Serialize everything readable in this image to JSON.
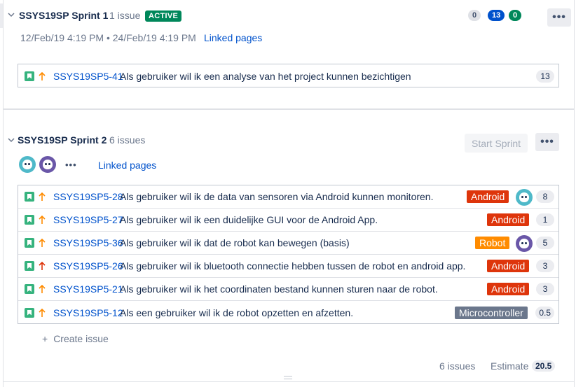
{
  "sprint1": {
    "name": "SSYS19SP Sprint 1",
    "issue_count": "1 issue",
    "status": "ACTIVE",
    "counts": {
      "todo": "0",
      "in_progress": "13",
      "done": "0"
    },
    "more": "•••",
    "dates": "12/Feb/19 4:19 PM • 24/Feb/19 4:19 PM",
    "linked_pages": "Linked pages",
    "issues": [
      {
        "key": "SSYS19SP5-41",
        "summary": "Als gebruiker wil ik een analyse van het project kunnen bezichtigen",
        "estimate": "13",
        "priority_color": "#ff8b00"
      }
    ]
  },
  "sprint2": {
    "name": "SSYS19SP Sprint 2",
    "issue_count": "6 issues",
    "start_sprint": "Start Sprint",
    "more": "•••",
    "assignee_more": "•••",
    "linked_pages": "Linked pages",
    "issues": [
      {
        "key": "SSYS19SP5-28",
        "summary": "Als gebruiker wil ik de data van sensoren via Android kunnen monitoren.",
        "epic": "Android",
        "estimate": "8",
        "priority_color": "#ff8b00"
      },
      {
        "key": "SSYS19SP5-27",
        "summary": "Als gebruiker wil ik een duidelijke GUI voor de Android App.",
        "epic": "Android",
        "estimate": "1",
        "priority_color": "#ff8b00"
      },
      {
        "key": "SSYS19SP5-36",
        "summary": "Als gebruiker wil ik dat de robot kan bewegen (basis)",
        "epic": "Robot",
        "estimate": "5",
        "priority_color": "#ff8b00"
      },
      {
        "key": "SSYS19SP5-26",
        "summary": "Als gebruiker wil ik bluetooth connectie hebben tussen de robot en android app.",
        "epic": "Android",
        "estimate": "3",
        "priority_color": "#de350b"
      },
      {
        "key": "SSYS19SP5-21",
        "summary": "Als gebruiker wil ik het coordinaten bestand kunnen sturen naar de robot.",
        "epic": "Android",
        "estimate": "3",
        "priority_color": "#ff8b00"
      },
      {
        "key": "SSYS19SP5-12",
        "summary": "Als een gebruiker wil ik de robot opzetten en afzetten.",
        "epic": "Microcontroller",
        "estimate": "0.5",
        "priority_color": "#ff8b00"
      }
    ],
    "create_issue": "Create issue",
    "footer": {
      "issues": "6 issues",
      "estimate_label": "Estimate",
      "estimate_total": "20.5"
    }
  },
  "colors": {
    "accent": "#0052cc",
    "active": "#00875a",
    "android_epic": "#de350b",
    "robot_epic": "#ff8b00",
    "micro_epic": "#6b778c"
  }
}
